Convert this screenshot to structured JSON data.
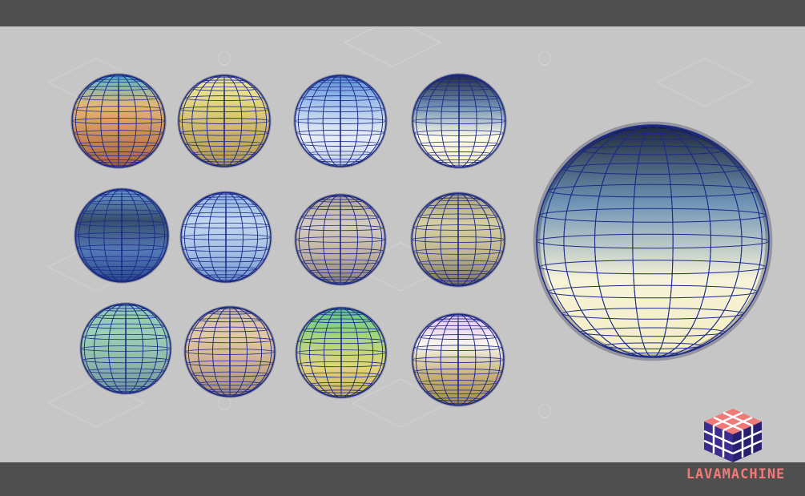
{
  "brand": {
    "name": "LAVAMACHINE",
    "color": "#f07a78",
    "logo_icon": "lava-cube-logo-icon",
    "logo_colors": {
      "top": "#f07a78",
      "left": "#3a2d8f",
      "right": "#2a2070",
      "grid": "#ffffff"
    }
  },
  "background": {
    "canvas": "#c6c6c6",
    "bars": "#4f4f4f",
    "wireframe": "#1c2a8a"
  },
  "spheres": [
    {
      "name": "sphere-desert-sunset",
      "colors": [
        "#4fb8d0",
        "#e7b872",
        "#c98a55",
        "#a86640"
      ],
      "highlight": "#ffffff"
    },
    {
      "name": "sphere-sandy-yellow",
      "colors": [
        "#f0eba0",
        "#e2d37a",
        "#c9b065",
        "#b69a58"
      ],
      "highlight": "#ffffff"
    },
    {
      "name": "sphere-blue-cloudy",
      "colors": [
        "#5a8fd8",
        "#a9c7ec",
        "#e9eef6",
        "#c5d3e8"
      ],
      "highlight": "#ffffff"
    },
    {
      "name": "sphere-dusk-clouds",
      "colors": [
        "#232a3a",
        "#6e8eb0",
        "#fdfbe7",
        "#f5efc5"
      ],
      "highlight": "#ffffff"
    },
    {
      "name": "sphere-dark-blue-sea",
      "colors": [
        "#6c9fd4",
        "#384f6c",
        "#5378b7",
        "#2b4a8a"
      ],
      "highlight": "#ffffff"
    },
    {
      "name": "sphere-light-blue-sky",
      "colors": [
        "#8fb4e2",
        "#c2d7ef",
        "#a4bfe2",
        "#6f93cf"
      ],
      "highlight": "#ffffff"
    },
    {
      "name": "sphere-grey-haze",
      "colors": [
        "#b7a58d",
        "#d5ccc0",
        "#bfb3a2",
        "#8f8176"
      ],
      "highlight": "#ffffff"
    },
    {
      "name": "sphere-olive-dusk",
      "colors": [
        "#a6a07c",
        "#d6cfa2",
        "#bfb58e",
        "#7a6f5a"
      ],
      "highlight": "#ffffff"
    },
    {
      "name": "sphere-teal-green",
      "colors": [
        "#8cc6b6",
        "#9ad0b6",
        "#8fb8a8",
        "#6f94a0"
      ],
      "highlight": "#ffffff"
    },
    {
      "name": "sphere-peach-tan",
      "colors": [
        "#d3bca0",
        "#e4c9a6",
        "#c9ad8c",
        "#a48a73"
      ],
      "highlight": "#ffffff"
    },
    {
      "name": "sphere-green-yellow",
      "colors": [
        "#5fc88e",
        "#a6d67a",
        "#e4d47c",
        "#c8b062"
      ],
      "highlight": "#ffffff"
    },
    {
      "name": "sphere-pink-sand",
      "colors": [
        "#e7c2f0",
        "#f7f5ee",
        "#c8b27a",
        "#a88e4e"
      ],
      "highlight": "#ffffff"
    },
    {
      "name": "sphere-large-dusk-clouds",
      "colors": [
        "#1f2738",
        "#6e93b4",
        "#f7f3d8",
        "#f2edbf"
      ],
      "highlight": "#ffffff"
    }
  ]
}
